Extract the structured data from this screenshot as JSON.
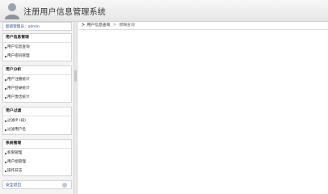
{
  "header": {
    "title": "注册用户信息管理系统"
  },
  "sidebar": {
    "welcome": "超级管理员：admin",
    "groups": [
      {
        "title": "用户信息管理",
        "items": [
          {
            "label": "用户信息查询"
          },
          {
            "label": "用户密码管理"
          }
        ]
      },
      {
        "title": "用户分析",
        "items": [
          {
            "label": "用户注册统计"
          },
          {
            "label": "用户登录统计"
          },
          {
            "label": "用户激活统计"
          }
        ]
      },
      {
        "title": "用户过滤",
        "items": [
          {
            "label": "过滤IP (段)"
          },
          {
            "label": "过滤用户名"
          }
        ]
      },
      {
        "title": "系统管理",
        "items": [
          {
            "label": "权限管理"
          },
          {
            "label": "用户组管理"
          },
          {
            "label": "操作日志"
          }
        ]
      }
    ],
    "logout": "安全退出"
  },
  "breadcrumb": {
    "arrow": ">",
    "parent": "用户信息查询",
    "separator": ">",
    "current": "模糊查询"
  }
}
